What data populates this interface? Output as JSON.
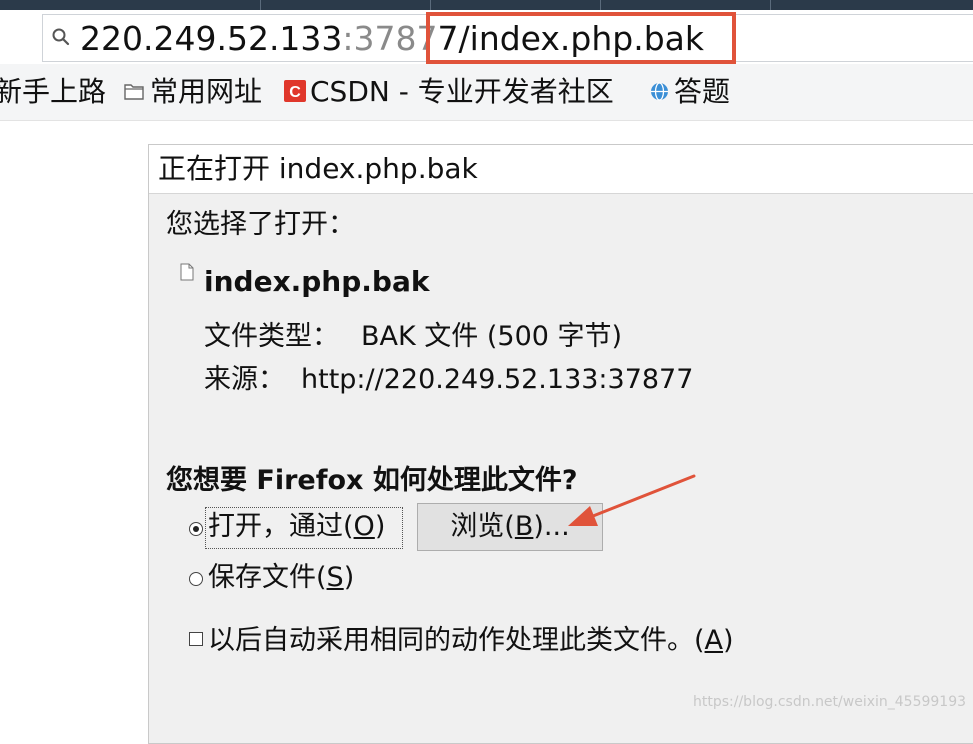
{
  "browser": {
    "address_bar": {
      "host": "220.249.52.133",
      "port": ":3787",
      "path": "7/index.php.bak",
      "highlight_color": "#e0533a"
    },
    "bookmarks": [
      {
        "label": "新手上路",
        "icon": "none"
      },
      {
        "label": "常用网址",
        "icon": "folder-icon"
      },
      {
        "label": "CSDN - 专业开发者社区",
        "icon": "csdn-logo-icon"
      },
      {
        "label": "答题",
        "icon": "globe-icon"
      }
    ]
  },
  "dialog": {
    "title": "正在打开 index.php.bak",
    "intro": "您选择了打开：",
    "file_name": "index.php.bak",
    "file_type_label": "文件类型：",
    "file_type_value": "BAK 文件 (500 字节)",
    "source_label": "来源：",
    "source_value": "http://220.249.52.133:37877",
    "question": "您想要 Firefox 如何处理此文件?",
    "open_with": {
      "text": "打开，通过(",
      "key": "O",
      "end": ")",
      "selected": true
    },
    "browse_button": {
      "text": "浏览(",
      "key": "B",
      "end": ")..."
    },
    "save_file": {
      "text": "保存文件(",
      "key": "S",
      "end": ")",
      "selected": false
    },
    "auto_action": {
      "text": "以后自动采用相同的动作处理此类文件。(",
      "key": "A",
      "end": ")",
      "checked": false
    }
  },
  "annotation": {
    "arrow_color": "#e0533a"
  },
  "watermark": "https://blog.csdn.net/weixin_45599193"
}
